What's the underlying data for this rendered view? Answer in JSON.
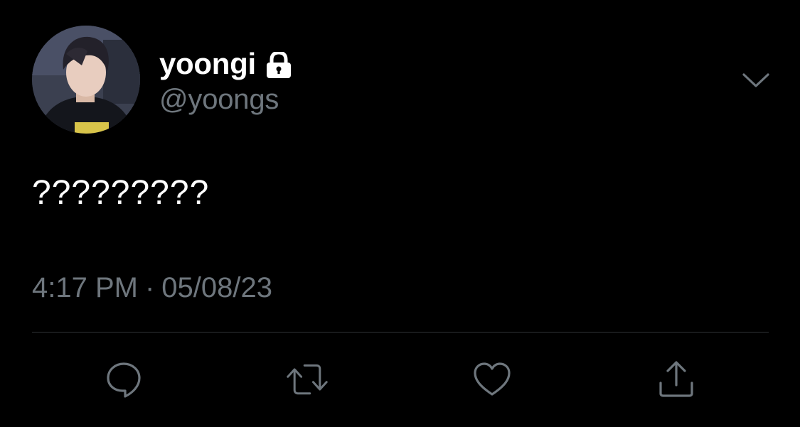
{
  "user": {
    "display_name": "yoongi",
    "handle": "@yoongs",
    "protected_icon": "lock-icon",
    "avatar_icon": "profile-photo"
  },
  "tweet": {
    "text": "?????????",
    "time": "4:17 PM",
    "separator": "·",
    "date": "05/08/23"
  },
  "actions": [
    {
      "name": "reply",
      "icon": "comment-icon"
    },
    {
      "name": "retweet",
      "icon": "retweet-icon"
    },
    {
      "name": "like",
      "icon": "heart-icon"
    },
    {
      "name": "share",
      "icon": "share-icon"
    }
  ],
  "menu": {
    "icon": "chevron-down-icon"
  },
  "colors": {
    "background": "#000000",
    "primary_text": "#ffffff",
    "secondary_text": "#6e767d",
    "divider": "#2f3336",
    "icon": "#6e767d"
  }
}
